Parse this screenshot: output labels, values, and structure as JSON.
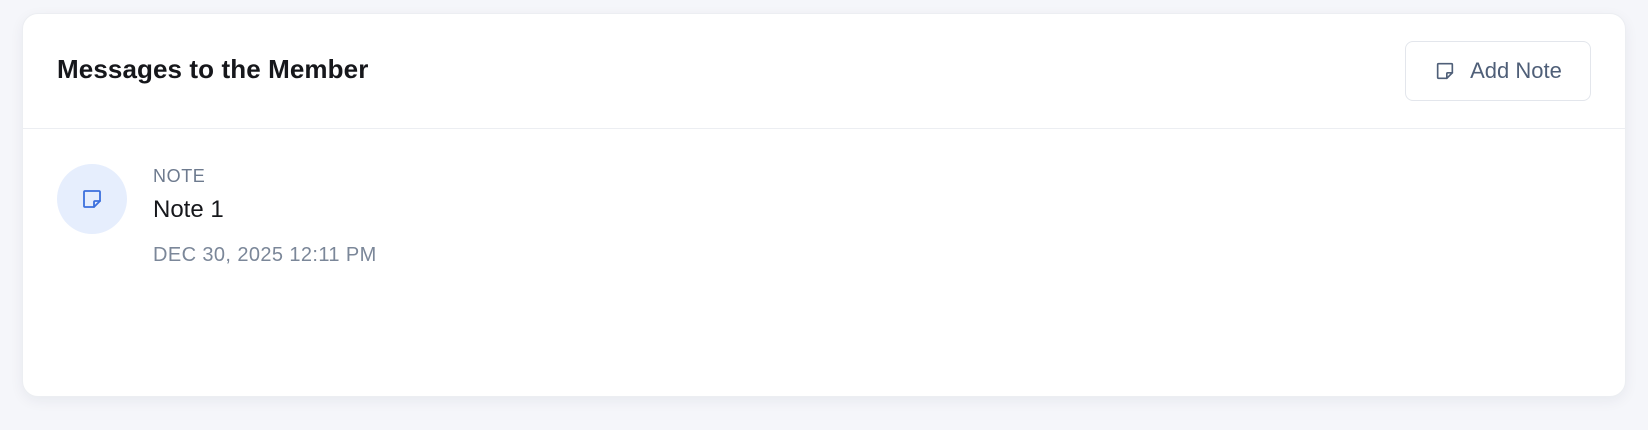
{
  "card": {
    "title": "Messages to the Member",
    "add_note_label": "Add Note"
  },
  "notes": [
    {
      "type": "NOTE",
      "text": "Note 1",
      "date": "DEC 30, 2025 12:11 PM",
      "icon": "sticky-note-icon"
    }
  ],
  "colors": {
    "background": "#f5f6fa",
    "card": "#ffffff",
    "avatar_bg": "#e6eefd",
    "accent_icon": "#3b6fdd",
    "muted_text": "#6d7a8e"
  }
}
